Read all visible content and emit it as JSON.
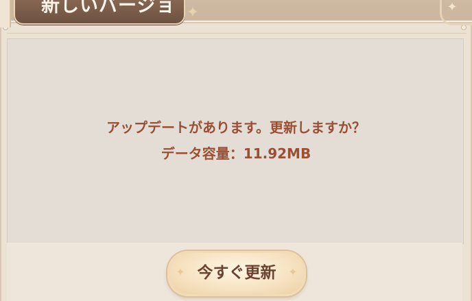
{
  "dialog": {
    "title": "新しいバージョ",
    "message_line1": "アップデートがあります。更新しますか？",
    "message_line2": "データ容量：11.92MB",
    "update_button_label": "今すぐ更新"
  },
  "icons": {
    "title_ornament": "star-ornament-icon",
    "corner_ornament": "star-ornament-icon",
    "button_sparkle": "sparkle-icon"
  },
  "colors": {
    "title_tab": "#7a5c4a",
    "message_text": "#9a4f33",
    "button_face": "#f7e3c3",
    "button_text": "#6a4232",
    "panel": "#e3ddd6"
  }
}
